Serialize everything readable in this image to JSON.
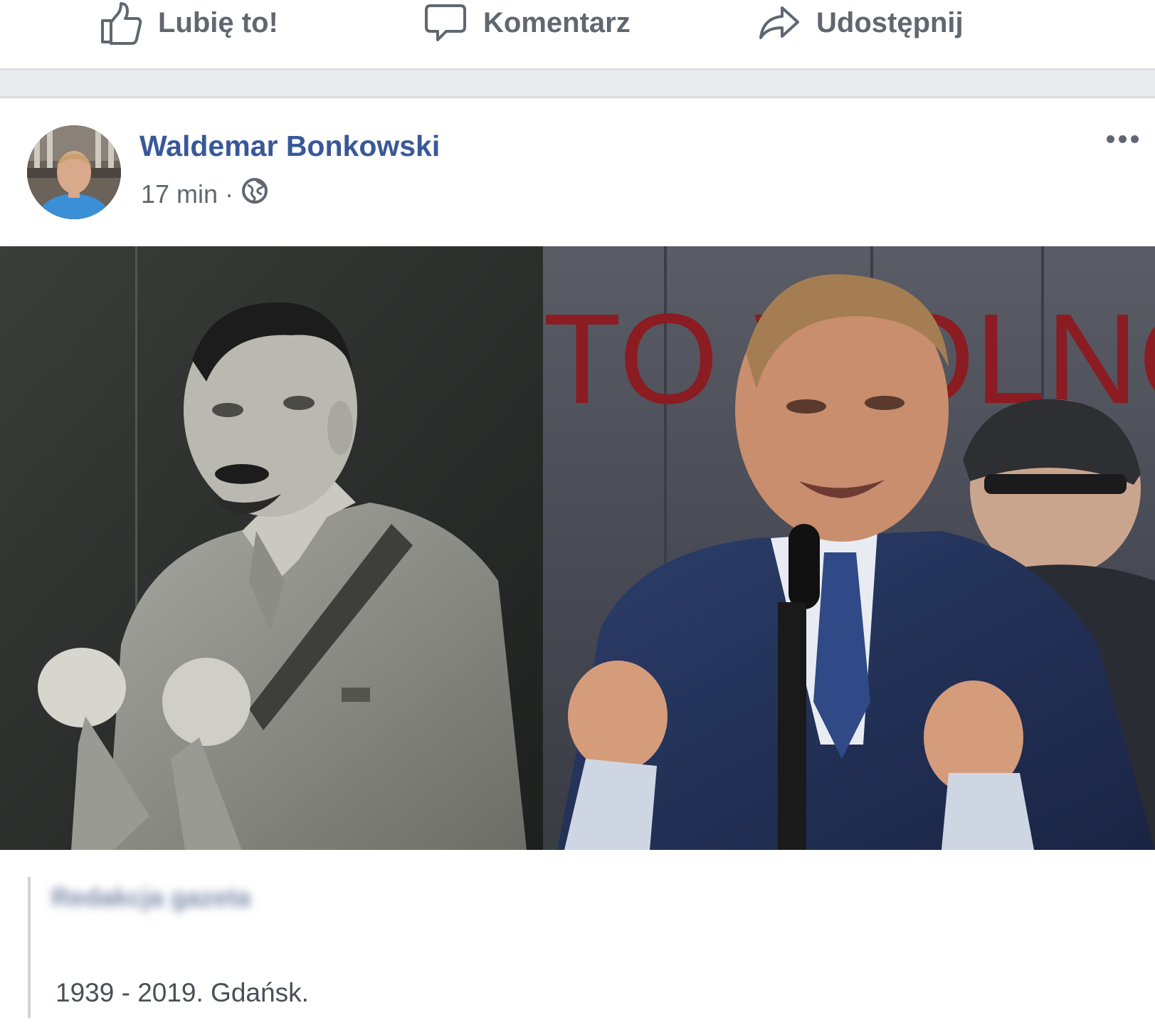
{
  "actions": {
    "like_label": "Lubię to!",
    "comment_label": "Komentarz",
    "share_label": "Udostępnij"
  },
  "post": {
    "author": "Waldemar Bonkowski",
    "timestamp": "17 min",
    "separator": "·",
    "privacy_icon": "globe-icon",
    "more_icon": "more-options-icon",
    "banner_text": "TO WOLNOŚ",
    "shared_name": "Redakcja gazeta",
    "text": "1939 - 2019. Gdańsk."
  },
  "colors": {
    "link": "#385898",
    "secondary_text": "#606770",
    "separator": "#e9ebee",
    "banner_red": "#8a1c22"
  }
}
